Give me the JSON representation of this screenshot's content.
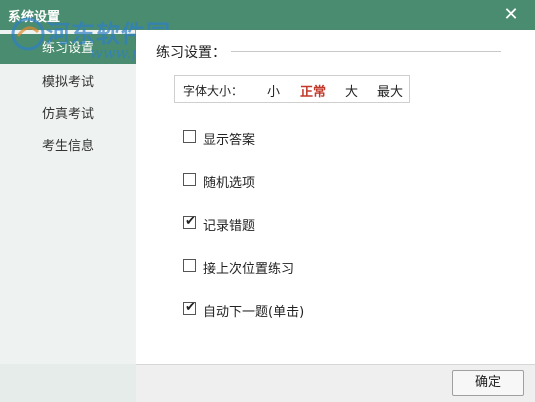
{
  "window": {
    "title": "系统设置",
    "close_icon": "close-icon"
  },
  "watermark": {
    "text": "河东软件园",
    "url": "www.pc0359.cn"
  },
  "sidebar": {
    "items": [
      {
        "label": "练习设置",
        "active": true
      },
      {
        "label": "模拟考试",
        "active": false
      },
      {
        "label": "仿真考试",
        "active": false
      },
      {
        "label": "考生信息",
        "active": false
      }
    ]
  },
  "main": {
    "section_title": "练习设置：",
    "font_size": {
      "label": "字体大小：",
      "options": [
        "小",
        "正常",
        "大",
        "最大"
      ],
      "selected": "正常"
    },
    "options": [
      {
        "label": "显示答案",
        "checked": false
      },
      {
        "label": "随机选项",
        "checked": false
      },
      {
        "label": "记录错题",
        "checked": true
      },
      {
        "label": "接上次位置练习",
        "checked": false
      },
      {
        "label": "自动下一题(单击)",
        "checked": true
      }
    ]
  },
  "footer": {
    "ok_label": "确定"
  },
  "colors": {
    "accent": "#4a8c6f",
    "selected_text": "#c0392b"
  }
}
